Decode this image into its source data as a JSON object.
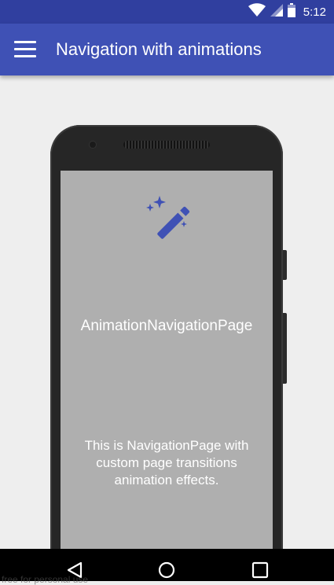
{
  "status_bar": {
    "time": "5:12",
    "icons": [
      "wifi-icon",
      "signal-icon",
      "battery-icon"
    ]
  },
  "app_bar": {
    "title": "Navigation with animations",
    "menu_icon": "hamburger-menu-icon"
  },
  "content": {
    "icon": "magic-wand-icon",
    "page_title": "AnimationNavigationPage",
    "description": "This is NavigationPage with custom page transitions animation effects."
  },
  "nav_bar": {
    "buttons": [
      "back-icon",
      "home-icon",
      "recents-icon"
    ]
  },
  "watermark": "free for personal use",
  "colors": {
    "status_bar": "#303f9f",
    "app_bar": "#3f51b5",
    "background": "#eeeeee",
    "screen": "#afafaf",
    "wand": "#3f51b5"
  }
}
